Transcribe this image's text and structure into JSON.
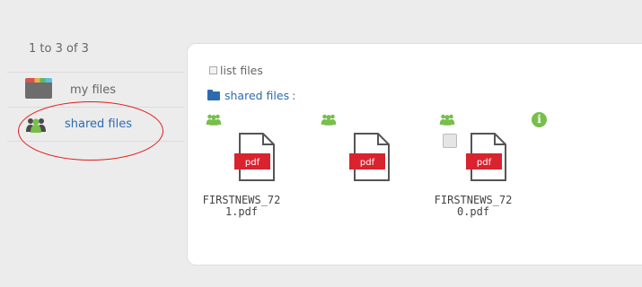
{
  "pager": {
    "text": "1 to 3 of 3"
  },
  "sidebar": {
    "items": [
      {
        "label": "my files",
        "icon": "folder-icon"
      },
      {
        "label": "shared files",
        "icon": "users-icon"
      }
    ]
  },
  "panel": {
    "list_files_label": "list files",
    "breadcrumb": {
      "label": "shared files",
      "separator": ":"
    },
    "files": [
      {
        "name_line1": "FIRSTNEWS_72",
        "name_line2": "1.pdf",
        "badge": "pdf"
      },
      {
        "name_line1": "",
        "name_line2": "",
        "badge": "pdf"
      },
      {
        "name_line1": "FIRSTNEWS_72",
        "name_line2": "0.pdf",
        "badge": "pdf"
      }
    ],
    "info_glyph": "i"
  },
  "colors": {
    "link": "#2c6bb0",
    "shared_green": "#78be4b",
    "pdf_red": "#d9232e",
    "highlight": "#e01b1b"
  }
}
